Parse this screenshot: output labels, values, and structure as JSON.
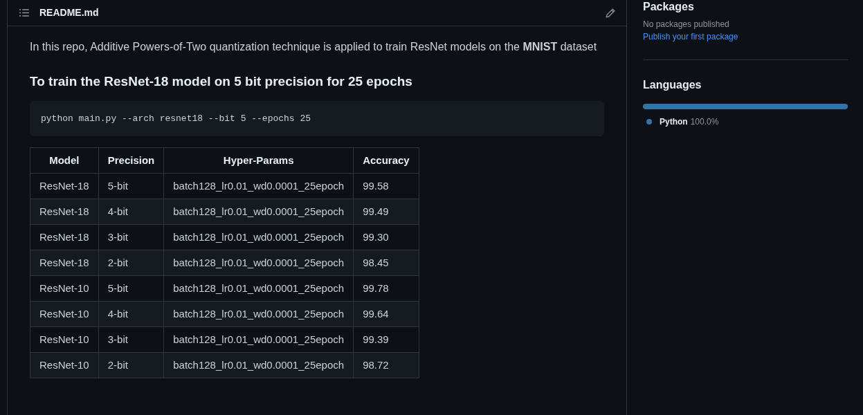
{
  "readme": {
    "filename": "README.md",
    "paragraph": "In this repo, Additive Powers-of-Two quantization technique is applied to train ResNet models on the **MNIST** dataset",
    "heading": "To train the ResNet-18 model on 5 bit precision for 25 epochs",
    "code": "python main.py --arch resnet18 --bit 5 --epochs 25",
    "table": {
      "columns": [
        "Model",
        "Precision",
        "Hyper-Params",
        "Accuracy"
      ],
      "rows": [
        [
          "ResNet-18",
          "5-bit",
          "batch128_lr0.01_wd0.0001_25epoch",
          "99.58"
        ],
        [
          "ResNet-18",
          "4-bit",
          "batch128_lr0.01_wd0.0001_25epoch",
          "99.49"
        ],
        [
          "ResNet-18",
          "3-bit",
          "batch128_lr0.01_wd0.0001_25epoch",
          "99.30"
        ],
        [
          "ResNet-18",
          "2-bit",
          "batch128_lr0.01_wd0.0001_25epoch",
          "98.45"
        ],
        [
          "ResNet-10",
          "5-bit",
          "batch128_lr0.01_wd0.0001_25epoch",
          "99.78"
        ],
        [
          "ResNet-10",
          "4-bit",
          "batch128_lr0.01_wd0.0001_25epoch",
          "99.64"
        ],
        [
          "ResNet-10",
          "3-bit",
          "batch128_lr0.01_wd0.0001_25epoch",
          "99.39"
        ],
        [
          "ResNet-10",
          "2-bit",
          "batch128_lr0.01_wd0.0001_25epoch",
          "98.72"
        ]
      ]
    }
  },
  "sidebar": {
    "packages": {
      "title": "Packages",
      "empty_text": "No packages published",
      "link": "Publish your first package"
    },
    "languages": {
      "title": "Languages",
      "items": [
        {
          "name": "Python",
          "percent": "100.0%",
          "level": 1.0,
          "color": "#3572a5"
        }
      ]
    }
  }
}
